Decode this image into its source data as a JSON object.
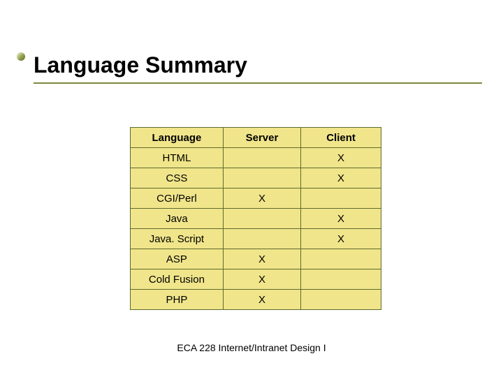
{
  "title": "Language Summary",
  "chart_data": {
    "type": "table",
    "columns": [
      "Language",
      "Server",
      "Client"
    ],
    "rows": [
      [
        "HTML",
        "",
        "X"
      ],
      [
        "CSS",
        "",
        "X"
      ],
      [
        "CGI/Perl",
        "X",
        ""
      ],
      [
        "Java",
        "",
        "X"
      ],
      [
        "Java. Script",
        "",
        "X"
      ],
      [
        "ASP",
        "X",
        ""
      ],
      [
        "Cold Fusion",
        "X",
        ""
      ],
      [
        "PHP",
        "X",
        ""
      ]
    ]
  },
  "footer": "ECA 228  Internet/Intranet Design I"
}
